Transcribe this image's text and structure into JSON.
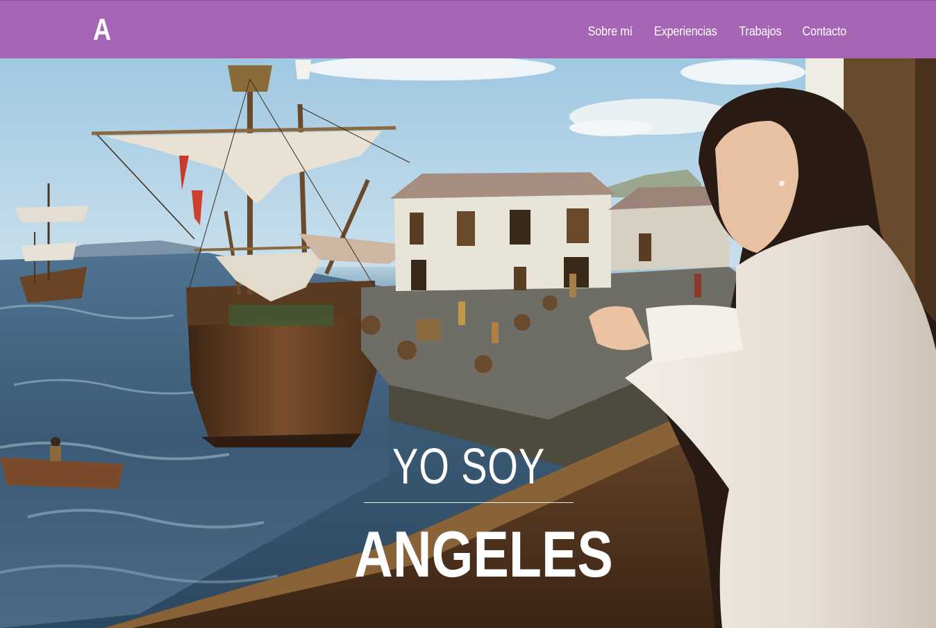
{
  "brand": {
    "logo_text": "A"
  },
  "nav": {
    "items": [
      {
        "label": "Sobre mí"
      },
      {
        "label": "Experiencias"
      },
      {
        "label": "Trabajos"
      },
      {
        "label": "Contacto"
      }
    ]
  },
  "hero": {
    "intro": "YO SOY",
    "name": "ANGELES"
  },
  "colors": {
    "navbar": "#a664b4",
    "text": "#ffffff"
  }
}
